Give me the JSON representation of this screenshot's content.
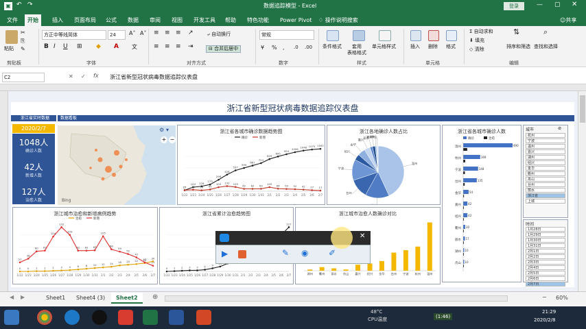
{
  "window": {
    "title": "数据追踪模型 - Excel",
    "login": "登录",
    "share": "共享"
  },
  "tabs": [
    "文件",
    "开始",
    "插入",
    "页面布局",
    "公式",
    "数据",
    "审阅",
    "视图",
    "开发工具",
    "帮助",
    "特色功能",
    "Power Pivot",
    "操作说明搜索"
  ],
  "ribbon": {
    "paste": "粘贴",
    "clipboard": "剪贴板",
    "font_name": "方正中等线简体",
    "font_size": "24",
    "font": "字体",
    "wrap": "自动换行",
    "merge": "合并后居中",
    "alignment": "对齐方式",
    "number_format": "常规",
    "number": "数字",
    "cond_format": "条件格式",
    "table_format": "套用\n表格格式",
    "cell_style": "单元格样式",
    "style": "样式",
    "insert": "插入",
    "delete": "删除",
    "format": "格式",
    "cells": "单元格",
    "autosum": "自动求和",
    "fill": "填充",
    "clear": "清除",
    "sort_filter": "排序和筛选",
    "find_select": "查找和选择",
    "editing": "编辑"
  },
  "formula_bar": {
    "name_box": "C2",
    "fx": "fx",
    "content": "浙江省新型冠状病毒数据追踪仪表盘"
  },
  "dashboard": {
    "title": "浙江省新型冠状病毒数据追踪仪表盘",
    "left_header": "浙江省实时数据",
    "map_header": "数据看板",
    "date": "2020/2/7",
    "kpis": [
      {
        "value": "1048人",
        "label": "确诊人数"
      },
      {
        "value": "42人",
        "label": "新增人数"
      },
      {
        "value": "127人",
        "label": "治愈人数"
      }
    ],
    "map_credit": "Bing",
    "panels": {
      "trend": "浙江省各城市确诊数据趋势图",
      "pie": "浙江各地确诊人数占比",
      "bars": "浙江省各城市确诊人数",
      "daily": "浙江城市治愈和新增病例趋势",
      "cure_trend": "浙江省累计治愈趋势图",
      "compare": "浙江城市治愈人数确诊对比"
    },
    "legends": {
      "trend": [
        "确诊",
        "新增"
      ],
      "bars": [
        "确诊",
        "治愈"
      ],
      "daily": [
        "治愈",
        "新增"
      ]
    },
    "slicer_city": {
      "title": "城市",
      "items": [
        "杭州",
        "宁波",
        "温州",
        "嘉兴",
        "湖州",
        "绍兴",
        "金华",
        "衢州",
        "舟山",
        "台州",
        "丽水",
        "浙江省",
        "上城"
      ]
    },
    "slicer_date": {
      "title": "时间",
      "items": [
        "1月28日",
        "1月29日",
        "1月30日",
        "1月31日",
        "2月1日",
        "2月2日",
        "2月3日",
        "2月4日",
        "2月5日",
        "2月6日",
        "2月7日"
      ]
    }
  },
  "sheets": [
    "Sheet1",
    "Sheet4 (3)",
    "Sheet2"
  ],
  "zoom": "60%",
  "taskbar": {
    "temp": "48°C",
    "cpu": "CPU温度",
    "timer": "(1:46)",
    "time": "21:29",
    "date": "2020/2/8"
  },
  "chart_data": [
    {
      "type": "line",
      "title": "浙江省各城市确诊数据趋势图",
      "categories": [
        "1/22",
        "1/23",
        "1/24",
        "1/25",
        "1/26",
        "1/27",
        "1/28",
        "1/29",
        "1/30",
        "1/31",
        "2/1",
        "2/2",
        "2/3",
        "2/4",
        "2/5",
        "2/6",
        "2/7"
      ],
      "series": [
        {
          "name": "确诊",
          "values": [
            27,
            104,
            128,
            173,
            296,
            428,
            537,
            599,
            661,
            724,
            829,
            895,
            954,
            1006,
            1048,
            1075,
            1092
          ]
        },
        {
          "name": "新增",
          "values": [
            27,
            38,
            24,
            45,
            104,
            132,
            109,
            62,
            62,
            63,
            105,
            66,
            59,
            52,
            42,
            27,
            17
          ]
        }
      ]
    },
    {
      "type": "pie",
      "title": "浙江各地确诊人数占比",
      "categories": [
        "温州",
        "杭州",
        "台州",
        "宁波",
        "绍兴",
        "金华",
        "嘉兴",
        "丽水",
        "衢州",
        "湖州",
        "舟山"
      ],
      "values": [
        490,
        169,
        135,
        148,
        42,
        54,
        42,
        17,
        20,
        10,
        10
      ]
    },
    {
      "type": "bar",
      "title": "浙江省各城市确诊人数",
      "categories": [
        "温州",
        "杭州",
        "宁波",
        "台州",
        "金华",
        "嘉兴",
        "绍兴",
        "衢州",
        "丽水",
        "湖州",
        "舟山"
      ],
      "series": [
        {
          "name": "确诊",
          "values": [
            490,
            169,
            148,
            135,
            54,
            42,
            42,
            20,
            17,
            10,
            10
          ]
        },
        {
          "name": "治愈",
          "values": [
            40,
            20,
            17,
            15,
            8,
            5,
            6,
            3,
            2,
            2,
            1
          ]
        }
      ]
    },
    {
      "type": "line",
      "title": "浙江城市治愈和新增病例趋势",
      "categories": [
        "1/22",
        "1/23",
        "1/24",
        "1/25",
        "1/26",
        "1/27",
        "1/28",
        "1/29",
        "1/30",
        "1/31",
        "2/1",
        "2/2",
        "2/3",
        "2/4",
        "2/5",
        "2/6",
        "2/7"
      ],
      "series": [
        {
          "name": "治愈",
          "values": [
            0,
            0,
            1,
            1,
            2,
            3,
            4,
            6,
            8,
            10,
            12,
            14,
            18,
            20,
            22,
            25,
            30
          ]
        },
        {
          "name": "新增",
          "values": [
            27,
            38,
            60,
            62,
            104,
            132,
            109,
            62,
            62,
            63,
            105,
            66,
            59,
            52,
            42,
            27,
            17
          ]
        }
      ]
    },
    {
      "type": "line",
      "title": "浙江省累计治愈趋势图",
      "categories": [
        "1/22",
        "1/23",
        "1/24",
        "1/25",
        "1/26",
        "1/27",
        "1/28",
        "1/29",
        "1/30",
        "1/31",
        "2/1",
        "2/2",
        "2/3",
        "2/4",
        "2/5",
        "2/6",
        "2/7"
      ],
      "series": [
        {
          "name": "累计治愈",
          "values": [
            0,
            1,
            2,
            3,
            3,
            5,
            9,
            14,
            23,
            32,
            40,
            48,
            58,
            67,
            83,
            105,
            127
          ]
        }
      ]
    },
    {
      "type": "bar",
      "title": "浙江城市治愈人数确诊对比",
      "categories": [
        "湖州",
        "衢州",
        "丽水",
        "舟山",
        "嘉兴",
        "绍兴",
        "金华",
        "台州",
        "宁波",
        "杭州",
        "温州"
      ],
      "values": [
        1,
        3,
        2,
        1,
        5,
        6,
        8,
        15,
        17,
        20,
        40
      ]
    }
  ]
}
